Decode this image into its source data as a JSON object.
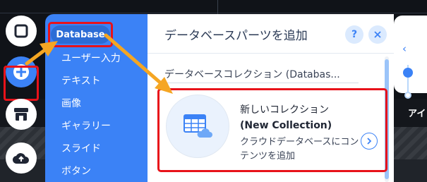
{
  "background": {
    "right_heading": "アイ"
  },
  "categories": {
    "active_label": "Database",
    "items": [
      "ユーザー入力",
      "テキスト",
      "画像",
      "ギャラリー",
      "スライド",
      "ボタン"
    ]
  },
  "add_panel": {
    "title": "データベースパーツを追加",
    "help_label": "?",
    "section_title": "データベースコレクション (Databas...",
    "card": {
      "title": "新しいコレクション",
      "subtitle": "(New Collection)",
      "description": "クラウドデータベースにコンテンツを追加"
    }
  },
  "icons": {
    "toolbar": [
      "square-icon",
      "plus-circle-icon",
      "store-icon",
      "upload-cloud-icon"
    ],
    "header": [
      "help-icon",
      "close-icon"
    ],
    "card": [
      "database-table-icon",
      "chevron-right-icon"
    ],
    "zoom": [
      "chevron-left-icon"
    ]
  },
  "colors": {
    "accent": "#3b82f6",
    "highlight_frame": "#e8121a",
    "annotation_arrow": "#f5a623"
  }
}
